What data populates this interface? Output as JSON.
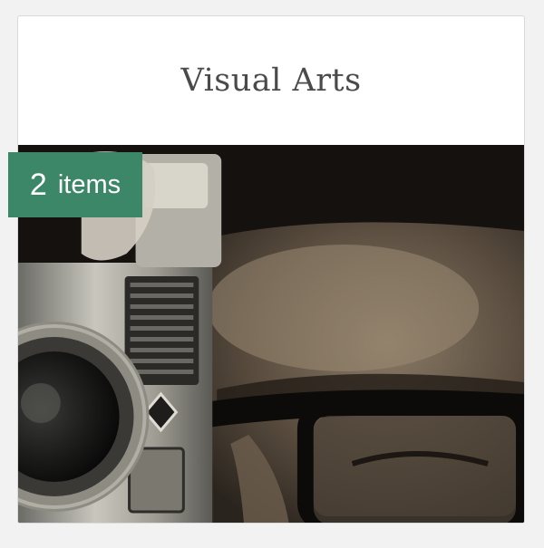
{
  "card": {
    "title": "Visual Arts",
    "item_count": "2",
    "item_label": "items",
    "image_icon": "photo-camera-portrait",
    "colors": {
      "badge": "#3d8769",
      "title_text": "#4a4a4a",
      "card_background": "#ffffff"
    }
  }
}
